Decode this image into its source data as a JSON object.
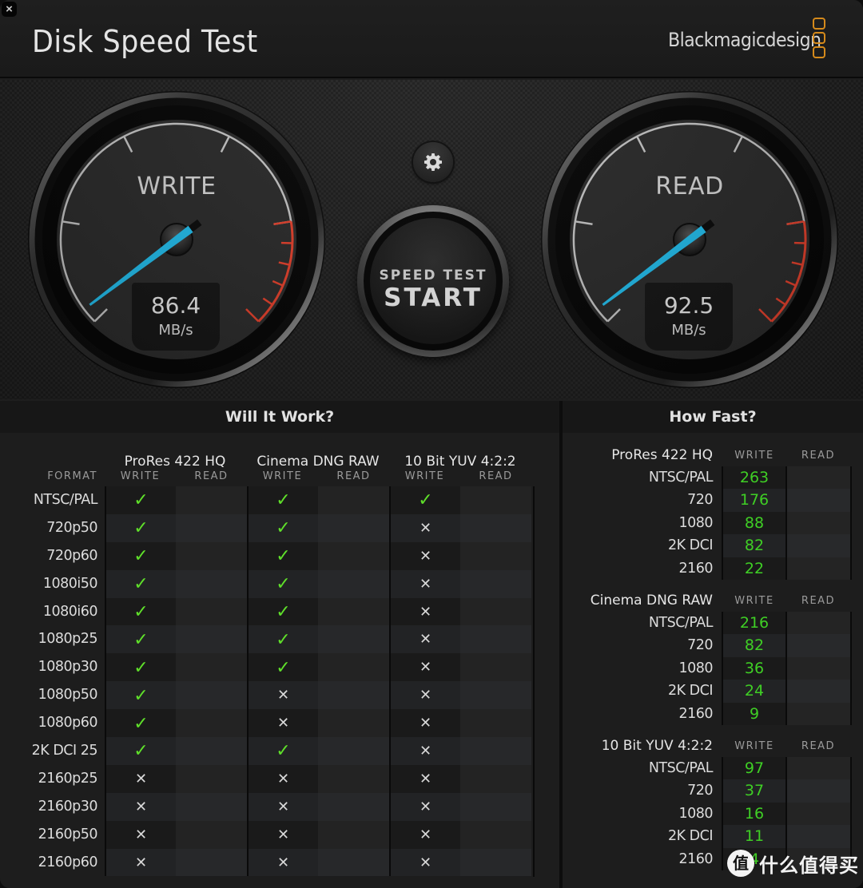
{
  "window": {
    "close_glyph": "×"
  },
  "header": {
    "title": "Disk Speed Test",
    "brand": "Blackmagicdesign",
    "brand_color": "#d58a1b"
  },
  "gauges": {
    "write": {
      "label": "WRITE",
      "value": "86.4",
      "unit": "MB/s",
      "needle_fraction": 0.1
    },
    "read": {
      "label": "READ",
      "value": "92.5",
      "unit": "MB/s",
      "needle_fraction": 0.1
    },
    "needle_color": "#22c0f0",
    "redline_color": "#e8412c"
  },
  "controls": {
    "settings_icon": "gear-icon",
    "start_small": "SPEED TEST",
    "start_big": "START"
  },
  "will_it_work": {
    "title": "Will It Work?",
    "format_header": "FORMAT",
    "codecs": [
      "ProRes 422 HQ",
      "Cinema DNG RAW",
      "10 Bit YUV 4:2:2"
    ],
    "subcols": [
      "WRITE",
      "READ"
    ],
    "ok_glyph": "✓",
    "no_glyph": "✕",
    "rows": [
      {
        "format": "NTSC/PAL",
        "prores_w": "ok",
        "dng_w": "ok",
        "yuv_w": "ok"
      },
      {
        "format": "720p50",
        "prores_w": "ok",
        "dng_w": "ok",
        "yuv_w": "no"
      },
      {
        "format": "720p60",
        "prores_w": "ok",
        "dng_w": "ok",
        "yuv_w": "no"
      },
      {
        "format": "1080i50",
        "prores_w": "ok",
        "dng_w": "ok",
        "yuv_w": "no"
      },
      {
        "format": "1080i60",
        "prores_w": "ok",
        "dng_w": "ok",
        "yuv_w": "no"
      },
      {
        "format": "1080p25",
        "prores_w": "ok",
        "dng_w": "ok",
        "yuv_w": "no"
      },
      {
        "format": "1080p30",
        "prores_w": "ok",
        "dng_w": "ok",
        "yuv_w": "no"
      },
      {
        "format": "1080p50",
        "prores_w": "ok",
        "dng_w": "no",
        "yuv_w": "no"
      },
      {
        "format": "1080p60",
        "prores_w": "ok",
        "dng_w": "no",
        "yuv_w": "no"
      },
      {
        "format": "2K DCI 25",
        "prores_w": "ok",
        "dng_w": "ok",
        "yuv_w": "no"
      },
      {
        "format": "2160p25",
        "prores_w": "no",
        "dng_w": "no",
        "yuv_w": "no"
      },
      {
        "format": "2160p30",
        "prores_w": "no",
        "dng_w": "no",
        "yuv_w": "no"
      },
      {
        "format": "2160p50",
        "prores_w": "no",
        "dng_w": "no",
        "yuv_w": "no"
      },
      {
        "format": "2160p60",
        "prores_w": "no",
        "dng_w": "no",
        "yuv_w": "no"
      }
    ]
  },
  "how_fast": {
    "title": "How Fast?",
    "write_header": "WRITE",
    "read_header": "READ",
    "sections": [
      {
        "codec": "ProRes 422 HQ",
        "rows": [
          {
            "format": "NTSC/PAL",
            "write": "263",
            "read": ""
          },
          {
            "format": "720",
            "write": "176",
            "read": ""
          },
          {
            "format": "1080",
            "write": "88",
            "read": ""
          },
          {
            "format": "2K DCI",
            "write": "82",
            "read": ""
          },
          {
            "format": "2160",
            "write": "22",
            "read": ""
          }
        ]
      },
      {
        "codec": "Cinema DNG RAW",
        "rows": [
          {
            "format": "NTSC/PAL",
            "write": "216",
            "read": ""
          },
          {
            "format": "720",
            "write": "82",
            "read": ""
          },
          {
            "format": "1080",
            "write": "36",
            "read": ""
          },
          {
            "format": "2K DCI",
            "write": "24",
            "read": ""
          },
          {
            "format": "2160",
            "write": "9",
            "read": ""
          }
        ]
      },
      {
        "codec": "10 Bit YUV 4:2:2",
        "rows": [
          {
            "format": "NTSC/PAL",
            "write": "97",
            "read": ""
          },
          {
            "format": "720",
            "write": "37",
            "read": ""
          },
          {
            "format": "1080",
            "write": "16",
            "read": ""
          },
          {
            "format": "2K DCI",
            "write": "11",
            "read": ""
          },
          {
            "format": "2160",
            "write": "4",
            "read": ""
          }
        ]
      }
    ]
  },
  "watermark": {
    "badge": "值",
    "text": "什么值得买"
  }
}
